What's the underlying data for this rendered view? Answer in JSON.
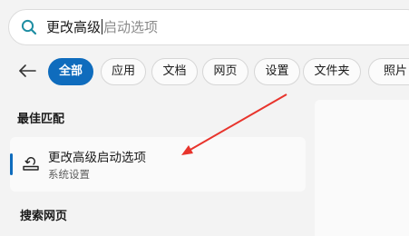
{
  "search": {
    "typed_text": "更改高级",
    "autocomplete_hint": "启动选项"
  },
  "filters": {
    "tabs": [
      {
        "label": "全部",
        "active": true
      },
      {
        "label": "应用"
      },
      {
        "label": "文档"
      },
      {
        "label": "网页"
      },
      {
        "label": "设置"
      },
      {
        "label": "文件夹"
      },
      {
        "label": "照片"
      }
    ]
  },
  "sections": {
    "best_match_title": "最佳匹配",
    "web_search_title": "搜索网页"
  },
  "best_match": {
    "title": "更改高级启动选项",
    "subtitle": "系统设置",
    "icon": "advanced-startup-icon"
  },
  "colors": {
    "accent": "#0f6cbd",
    "annotation_arrow": "#e8342c"
  }
}
